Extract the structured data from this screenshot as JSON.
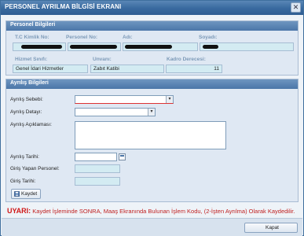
{
  "window": {
    "title": "PERSONEL AYRILMA BİLGİSİ EKRANI",
    "close_glyph": "✕"
  },
  "personel": {
    "header": "Personel Bilgileri",
    "tc_label": "T.C Kimlik No:",
    "personel_no_label": "Personel No:",
    "ad_label": "Adı:",
    "soyad_label": "Soyadı:",
    "hizmet_label": "Hizmet Sınıfı:",
    "unvan_label": "Unvanı:",
    "kadro_label": "Kadro Derecesi:",
    "hizmet_value": "Genel İdari Hizmetler",
    "unvan_value": "Zabıt Katibi",
    "kadro_value": "11"
  },
  "ayrilis": {
    "header": "Ayrılış Bilgileri",
    "sebebi_label": "Ayrılış Sebebi:",
    "detay_label": "Ayrılış Detayı:",
    "aciklama_label": "Ayrılış Açıklaması:",
    "tarih_label": "Ayrılış Tarihi:",
    "giris_personel_label": "Giriş Yapan Personel:",
    "giris_tarihi_label": "Giriş Tarihi:",
    "kaydet_label": "Kaydet"
  },
  "warning": {
    "prefix": "UYARI:",
    "text": "Kaydet İşleminde SONRA, Maaş Ekranında Bulunan İşlem Kodu, (2-İşten Ayrılma) Olarak Kaydedilir."
  },
  "footer": {
    "kapat_label": "Kapat"
  },
  "icons": {
    "dropdown": "chevron-down-icon",
    "calendar": "calendar-icon",
    "save": "floppy-disk-icon"
  }
}
